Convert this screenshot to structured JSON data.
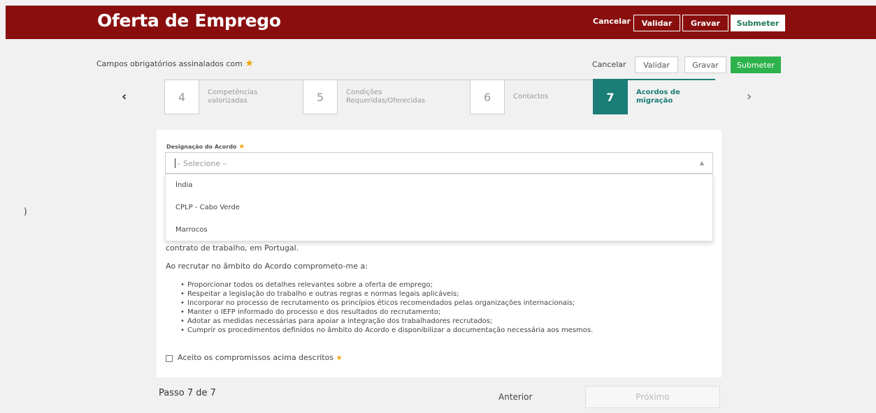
{
  "header": {
    "title": "Oferta de Emprego",
    "cancel": "Cancelar",
    "validate": "Validar",
    "save": "Gravar",
    "submit": "Submeter",
    "submit_color": "#1f7a5a",
    "bar_color": "#8a0e0e"
  },
  "required_note": "Campos obrigatórios assinalados com",
  "actions": {
    "cancel": "Cancelar",
    "validate": "Validar",
    "save": "Gravar",
    "submit": "Submeter",
    "submit_color": "#2db24c"
  },
  "stepper": {
    "steps": [
      {
        "number": "4",
        "label_1": "Competências",
        "label_2": "valorizadas"
      },
      {
        "number": "5",
        "label_1": "Condições",
        "label_2": "Requeridas/Oferecidas"
      },
      {
        "number": "6",
        "label_1": "Contactos",
        "label_2": ""
      },
      {
        "number": "7",
        "label_1": "Acordos de",
        "label_2": "migração",
        "active": true
      }
    ],
    "active_color": "#1a7d78"
  },
  "form": {
    "field_label": "Designação do Acordo",
    "select_placeholder": "– Selecione –",
    "options": [
      "Índia",
      "CPLP - Cabo Verde",
      "Marrocos"
    ],
    "para_1": "contrato de trabalho, em Portugal.",
    "para_2": "Ao recrutar no âmbito do Acordo comprometo-me a:",
    "commitments": [
      "Proporcionar todos os detalhes relevantes sobre a oferta de emprego;",
      "Respeitar a legislação do trabalho e outras regras e normas legais aplicáveis;",
      "Incorporar no processo de recrutamento os princípios éticos recomendados pelas organizações internacionais;",
      "Manter o IEFP informado do processo e dos resultados do recrutamento;",
      "Adotar as medidas necessárias para apoiar a integração dos trabalhadores recrutados;",
      "Cumprir os procedimentos definidos no âmbito do Acordo e disponibilizar a documentação necessária aos mesmos."
    ],
    "accept_label": "Aceito os compromissos acima descritos"
  },
  "footer": {
    "step_text": "Passo 7 de 7",
    "previous": "Anterior",
    "next": "Próximo"
  }
}
